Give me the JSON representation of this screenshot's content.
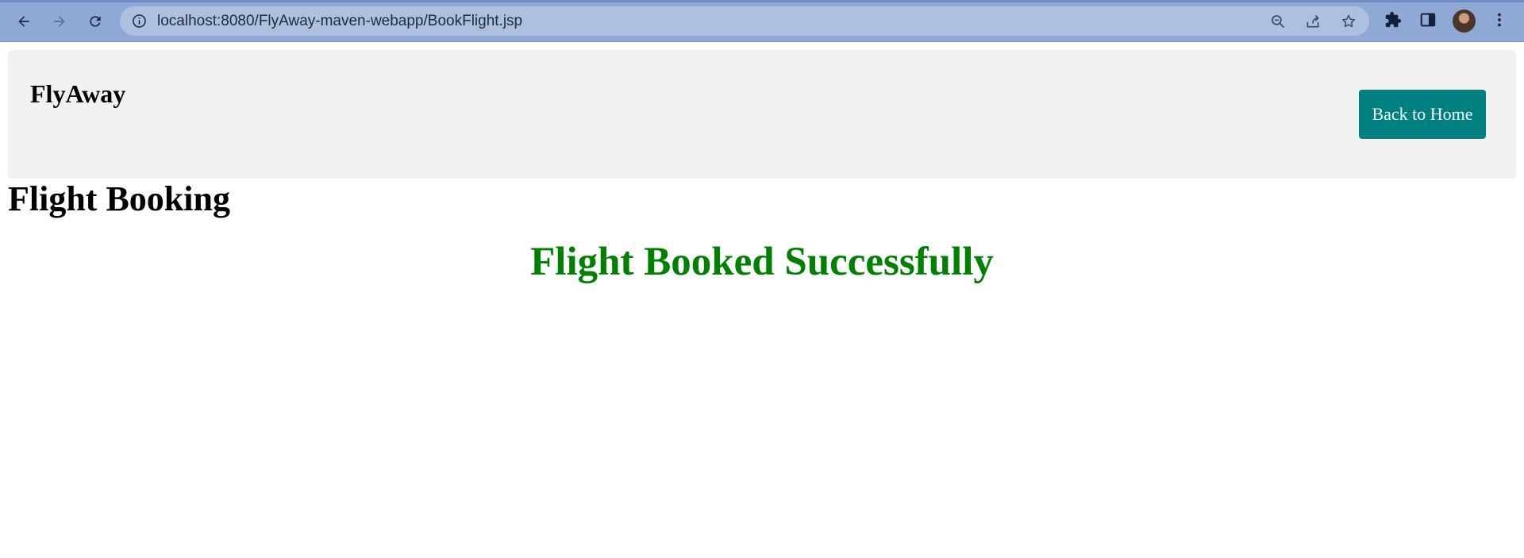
{
  "browser": {
    "url": "localhost:8080/FlyAway-maven-webapp/BookFlight.jsp",
    "icons": [
      "back-arrow-icon",
      "forward-arrow-icon",
      "reload-icon",
      "site-info-icon",
      "zoom-out-icon",
      "share-icon",
      "bookmark-star-icon",
      "extensions-puzzle-icon",
      "side-panel-icon",
      "profile-avatar",
      "more-menu-icon"
    ]
  },
  "header": {
    "brand": "FlyAway",
    "home_button_label": "Back to Home",
    "home_button_color": "#008080"
  },
  "main": {
    "title": "Flight Booking",
    "message": "Flight Booked Successfully",
    "message_color": "#008000"
  }
}
